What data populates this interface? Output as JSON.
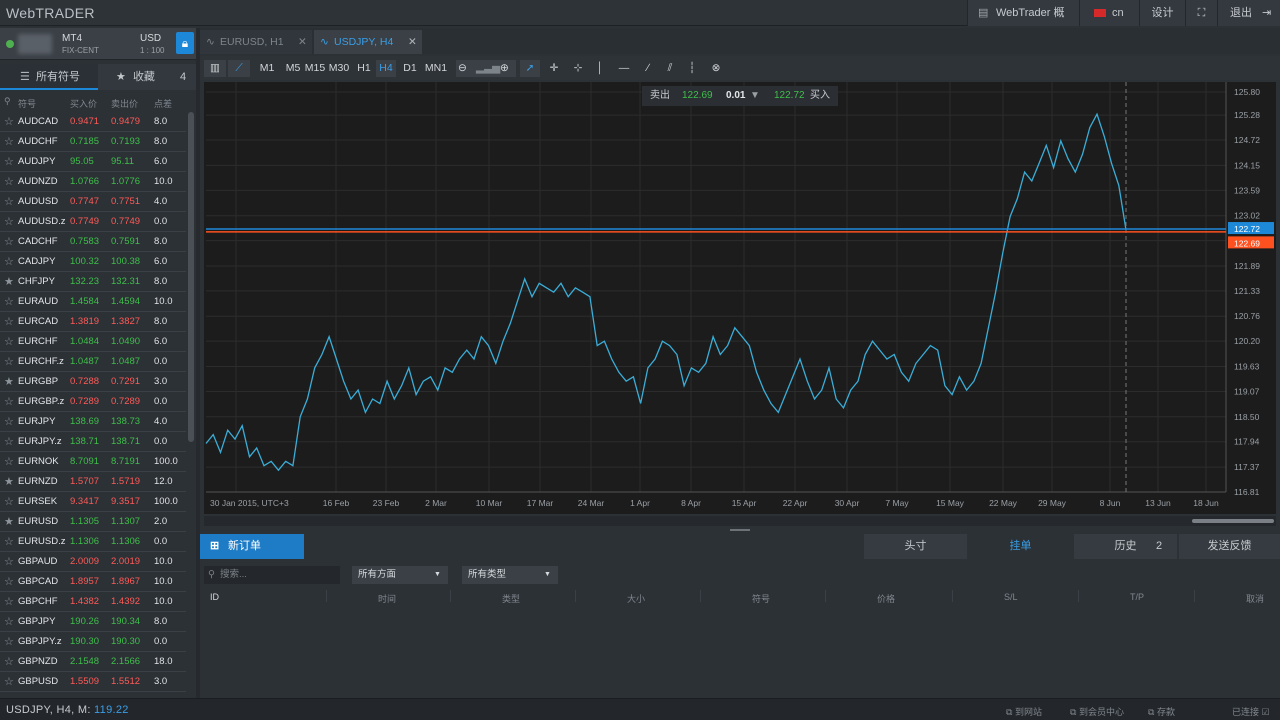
{
  "app": {
    "logo": "WebTRADER"
  },
  "topbar": {
    "overview": "WebTrader 概述",
    "lang": "cn",
    "design": "设计",
    "logout": "退出"
  },
  "account": {
    "platform": "MT4",
    "type": "FIX-CENT",
    "currency": "USD",
    "leverage": "1 : 100"
  },
  "symbols_tabs": {
    "all": "所有符号",
    "favorites": "收藏",
    "fav_count": "4"
  },
  "symbols_header": {
    "symbol": "符号",
    "bid": "买入价",
    "ask": "卖出价",
    "spread": "点差"
  },
  "symbols": [
    {
      "sym": "AUDCAD",
      "bid": "0.9471",
      "ask": "0.9479",
      "spr": "8.0",
      "dir": "dn",
      "fav": false
    },
    {
      "sym": "AUDCHF",
      "bid": "0.7185",
      "ask": "0.7193",
      "spr": "8.0",
      "dir": "up",
      "fav": false
    },
    {
      "sym": "AUDJPY",
      "bid": "95.05",
      "ask": "95.11",
      "spr": "6.0",
      "dir": "up",
      "fav": false
    },
    {
      "sym": "AUDNZD",
      "bid": "1.0766",
      "ask": "1.0776",
      "spr": "10.0",
      "dir": "up",
      "fav": false
    },
    {
      "sym": "AUDUSD",
      "bid": "0.7747",
      "ask": "0.7751",
      "spr": "4.0",
      "dir": "dn",
      "fav": false
    },
    {
      "sym": "AUDUSD.z",
      "bid": "0.7749",
      "ask": "0.7749",
      "spr": "0.0",
      "dir": "dn",
      "fav": false
    },
    {
      "sym": "CADCHF",
      "bid": "0.7583",
      "ask": "0.7591",
      "spr": "8.0",
      "dir": "up",
      "fav": false
    },
    {
      "sym": "CADJPY",
      "bid": "100.32",
      "ask": "100.38",
      "spr": "6.0",
      "dir": "up",
      "fav": false
    },
    {
      "sym": "CHFJPY",
      "bid": "132.23",
      "ask": "132.31",
      "spr": "8.0",
      "dir": "up",
      "fav": true
    },
    {
      "sym": "EURAUD",
      "bid": "1.4584",
      "ask": "1.4594",
      "spr": "10.0",
      "dir": "up",
      "fav": false
    },
    {
      "sym": "EURCAD",
      "bid": "1.3819",
      "ask": "1.3827",
      "spr": "8.0",
      "dir": "dn",
      "fav": false
    },
    {
      "sym": "EURCHF",
      "bid": "1.0484",
      "ask": "1.0490",
      "spr": "6.0",
      "dir": "up",
      "fav": false
    },
    {
      "sym": "EURCHF.z",
      "bid": "1.0487",
      "ask": "1.0487",
      "spr": "0.0",
      "dir": "up",
      "fav": false
    },
    {
      "sym": "EURGBP",
      "bid": "0.7288",
      "ask": "0.7291",
      "spr": "3.0",
      "dir": "dn",
      "fav": true
    },
    {
      "sym": "EURGBP.z",
      "bid": "0.7289",
      "ask": "0.7289",
      "spr": "0.0",
      "dir": "dn",
      "fav": false
    },
    {
      "sym": "EURJPY",
      "bid": "138.69",
      "ask": "138.73",
      "spr": "4.0",
      "dir": "up",
      "fav": false
    },
    {
      "sym": "EURJPY.z",
      "bid": "138.71",
      "ask": "138.71",
      "spr": "0.0",
      "dir": "up",
      "fav": false
    },
    {
      "sym": "EURNOK",
      "bid": "8.7091",
      "ask": "8.7191",
      "spr": "100.0",
      "dir": "up",
      "fav": false
    },
    {
      "sym": "EURNZD",
      "bid": "1.5707",
      "ask": "1.5719",
      "spr": "12.0",
      "dir": "dn",
      "fav": true
    },
    {
      "sym": "EURSEK",
      "bid": "9.3417",
      "ask": "9.3517",
      "spr": "100.0",
      "dir": "dn",
      "fav": false
    },
    {
      "sym": "EURUSD",
      "bid": "1.1305",
      "ask": "1.1307",
      "spr": "2.0",
      "dir": "up",
      "fav": true
    },
    {
      "sym": "EURUSD.z",
      "bid": "1.1306",
      "ask": "1.1306",
      "spr": "0.0",
      "dir": "up",
      "fav": false
    },
    {
      "sym": "GBPAUD",
      "bid": "2.0009",
      "ask": "2.0019",
      "spr": "10.0",
      "dir": "dn",
      "fav": false
    },
    {
      "sym": "GBPCAD",
      "bid": "1.8957",
      "ask": "1.8967",
      "spr": "10.0",
      "dir": "dn",
      "fav": false
    },
    {
      "sym": "GBPCHF",
      "bid": "1.4382",
      "ask": "1.4392",
      "spr": "10.0",
      "dir": "dn",
      "fav": false
    },
    {
      "sym": "GBPJPY",
      "bid": "190.26",
      "ask": "190.34",
      "spr": "8.0",
      "dir": "up",
      "fav": false
    },
    {
      "sym": "GBPJPY.z",
      "bid": "190.30",
      "ask": "190.30",
      "spr": "0.0",
      "dir": "up",
      "fav": false
    },
    {
      "sym": "GBPNZD",
      "bid": "2.1548",
      "ask": "2.1566",
      "spr": "18.0",
      "dir": "up",
      "fav": false
    },
    {
      "sym": "GBPUSD",
      "bid": "1.5509",
      "ask": "1.5512",
      "spr": "3.0",
      "dir": "dn",
      "fav": false
    }
  ],
  "chart_tabs": [
    {
      "label": "EURUSD, H1",
      "active": false
    },
    {
      "label": "USDJPY, H4",
      "active": true
    }
  ],
  "timeframes": [
    "M1",
    "M5",
    "M15",
    "M30",
    "H1",
    "H4",
    "D1",
    "MN1"
  ],
  "active_timeframe": "H4",
  "trade_panel": {
    "sell_label": "卖出",
    "sell_price": "122.69",
    "lot": "0.01",
    "buy_price": "122.72",
    "buy_label": "买入"
  },
  "chart_data": {
    "type": "line",
    "symbol": "USDJPY",
    "timeframe": "H4",
    "x_labels": [
      "30 Jan 2015, UTC+3",
      "16 Feb",
      "23 Feb",
      "2 Mar",
      "10 Mar",
      "17 Mar",
      "24 Mar",
      "1 Apr",
      "8 Apr",
      "15 Apr",
      "22 Apr",
      "30 Apr",
      "7 May",
      "15 May",
      "22 May",
      "29 May",
      "8 Jun",
      "13 Jun",
      "18 Jun"
    ],
    "y_ticks": [
      "125.80",
      "125.28",
      "124.72",
      "124.15",
      "123.59",
      "123.02",
      "122.46",
      "121.89",
      "121.33",
      "120.76",
      "120.20",
      "119.63",
      "119.07",
      "118.50",
      "117.94",
      "117.37",
      "116.81"
    ],
    "ylim": [
      116.81,
      125.8
    ],
    "series": [
      {
        "color": "#3aaed8",
        "values": [
          117.9,
          118.1,
          117.7,
          118.2,
          118.0,
          118.3,
          117.6,
          117.8,
          117.4,
          117.5,
          117.3,
          117.5,
          117.4,
          118.5,
          118.9,
          119.6,
          119.9,
          120.3,
          119.8,
          119.3,
          118.9,
          119.1,
          118.6,
          118.9,
          118.8,
          119.3,
          118.9,
          119.2,
          119.6,
          119.0,
          119.3,
          119.4,
          119.1,
          119.6,
          119.5,
          119.8,
          120.0,
          119.8,
          120.3,
          120.1,
          119.7,
          120.2,
          120.6,
          121.1,
          121.6,
          121.2,
          121.5,
          121.4,
          121.3,
          121.5,
          121.2,
          121.4,
          121.3,
          121.2,
          120.1,
          120.2,
          119.8,
          119.5,
          119.3,
          119.4,
          118.8,
          119.6,
          119.8,
          120.2,
          120.1,
          119.9,
          119.2,
          119.6,
          119.5,
          119.7,
          120.3,
          119.9,
          120.1,
          120.5,
          120.3,
          120.1,
          119.5,
          119.1,
          118.8,
          118.6,
          119.0,
          119.4,
          119.8,
          119.3,
          118.9,
          119.1,
          119.6,
          118.9,
          118.7,
          119.1,
          119.3,
          119.9,
          120.2,
          120.0,
          119.8,
          119.9,
          119.5,
          119.3,
          119.7,
          119.9,
          120.1,
          120.0,
          119.2,
          119.0,
          119.4,
          119.1,
          119.3,
          119.7,
          120.5,
          121.3,
          122.2,
          123.0,
          123.4,
          124.0,
          123.8,
          124.2,
          124.6,
          124.1,
          124.7,
          124.3,
          124.0,
          124.4,
          125.0,
          125.3,
          124.8,
          124.2,
          123.7,
          122.7
        ]
      }
    ],
    "bid_line": 122.69,
    "ask_line": 122.72,
    "bid_label": "122.69",
    "ask_label": "122.72"
  },
  "bottom": {
    "new_order": "新订单",
    "tabs": [
      {
        "label": "头寸"
      },
      {
        "label": "挂单",
        "active": true
      },
      {
        "label": "历史",
        "count": "2"
      },
      {
        "label": "发送反馈"
      }
    ],
    "search_placeholder": "搜索...",
    "filter_direction": "所有方面",
    "filter_type": "所有类型",
    "columns": [
      "ID",
      "时间",
      "类型",
      "大小",
      "符号",
      "价格",
      "S/L",
      "T/P",
      "取消"
    ]
  },
  "status": {
    "instrument": "USDJPY, H4, M:",
    "value": "119.22",
    "links": [
      "到网站",
      "到会员中心",
      "存款"
    ],
    "connected": "已连接"
  },
  "colors": {
    "accent": "#1e88d8",
    "up": "#3fbf4a",
    "down": "#ff5a57",
    "line": "#3aaed8",
    "bid": "#ff5020",
    "ask": "#1e88d8"
  }
}
